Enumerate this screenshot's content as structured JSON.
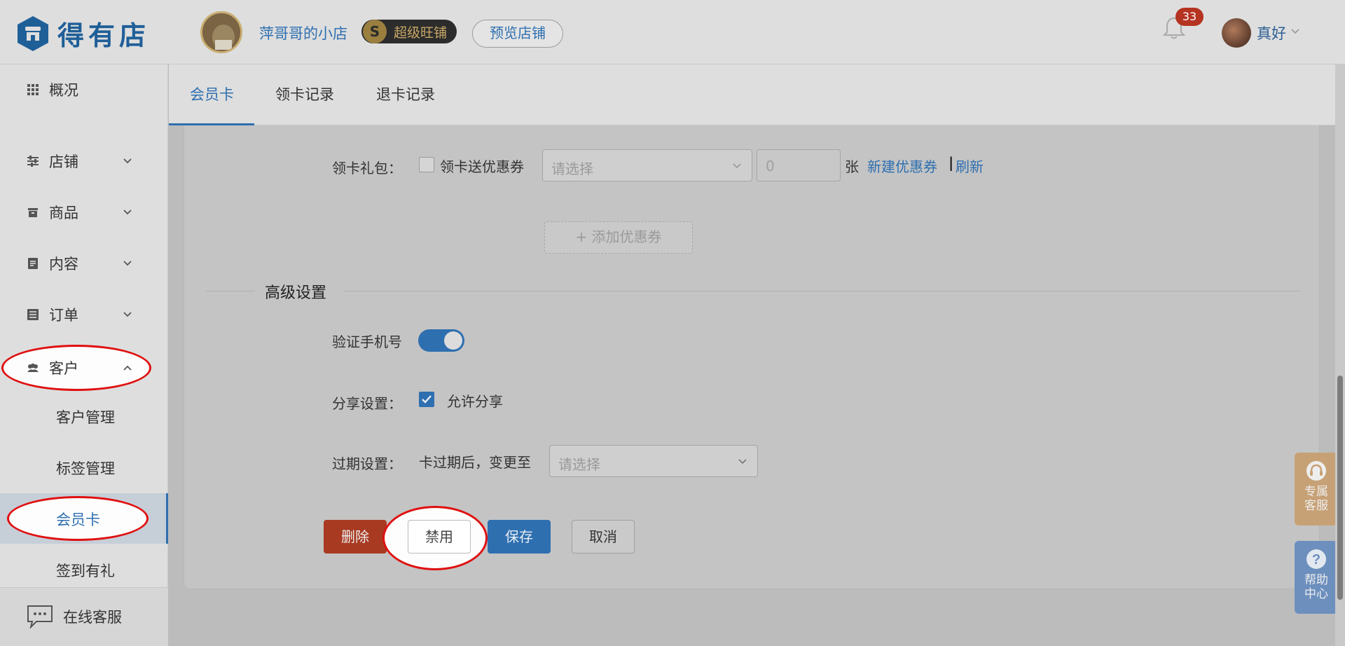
{
  "brand": {
    "name": "得有店",
    "color": "#1f5f98"
  },
  "header": {
    "shop_name": "萍哥哥的小店",
    "vip_letter": "S",
    "vip_label": "超级旺铺",
    "preview_button": "预览店铺",
    "notification_count": "33",
    "user_name": "真好"
  },
  "sidebar": {
    "items": [
      {
        "label": "概况",
        "icon": "grid-icon"
      },
      {
        "label": "店铺",
        "icon": "sliders-icon",
        "expandable": true
      },
      {
        "label": "商品",
        "icon": "box-icon",
        "expandable": true
      },
      {
        "label": "内容",
        "icon": "document-icon",
        "expandable": true
      },
      {
        "label": "订单",
        "icon": "list-icon",
        "expandable": true
      },
      {
        "label": "客户",
        "icon": "users-icon",
        "expanded": true
      }
    ],
    "sub_items": [
      {
        "label": "客户管理"
      },
      {
        "label": "标签管理"
      },
      {
        "label": "会员卡",
        "active": true
      },
      {
        "label": "签到有礼"
      }
    ],
    "footer_label": "在线客服"
  },
  "tabs": [
    {
      "label": "会员卡",
      "active": true
    },
    {
      "label": "领卡记录"
    },
    {
      "label": "退卡记录"
    }
  ],
  "form": {
    "gift_pack": {
      "label": "领卡礼包：",
      "checkbox_label": "领卡送优惠券",
      "select_placeholder": "请选择",
      "quantity_placeholder": "0",
      "unit": "张",
      "new_coupon_link": "新建优惠券",
      "separator": "|",
      "refresh_link": "刷新",
      "add_coupon_button": "+ 添加优惠券"
    },
    "advanced_title": "高级设置",
    "verify_phone": {
      "label": "验证手机号",
      "enabled": true
    },
    "share": {
      "label": "分享设置：",
      "checkbox_label": "允许分享",
      "checked": true
    },
    "expiry": {
      "label": "过期设置：",
      "text": "卡过期后，变更至",
      "select_placeholder": "请选择"
    }
  },
  "actions": {
    "delete": "删除",
    "disable": "禁用",
    "save": "保存",
    "cancel": "取消"
  },
  "floating": {
    "service_line1": "专属",
    "service_line2": "客服",
    "help_line1": "帮助",
    "help_line2": "中心"
  },
  "colors": {
    "accent": "#2e6fb0",
    "danger": "#a83a22",
    "highlight_ring": "#e01010"
  }
}
